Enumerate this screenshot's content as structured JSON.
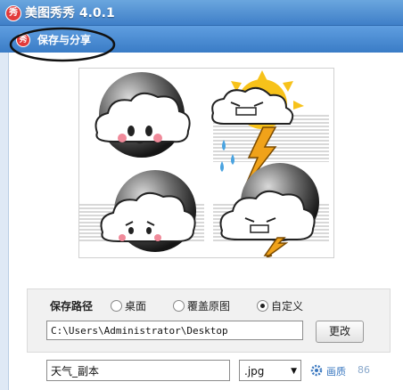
{
  "window": {
    "app_logo_text": "秀",
    "title": "美图秀秀 4.0.1"
  },
  "dialog": {
    "logo_text": "秀",
    "title": "保存与分享"
  },
  "save_path": {
    "label": "保存路径",
    "options": [
      {
        "label": "桌面",
        "checked": false
      },
      {
        "label": "覆盖原图",
        "checked": false
      },
      {
        "label": "自定义",
        "checked": true
      }
    ],
    "path_value": "C:\\Users\\Administrator\\Desktop",
    "change_button": "更改"
  },
  "file": {
    "name_value": "天气_副本",
    "format": ".jpg",
    "quality_label": "画质",
    "quality_value": "86"
  },
  "colors": {
    "title_bar": "#4a8ad4",
    "accent_link": "#3a78c0"
  }
}
